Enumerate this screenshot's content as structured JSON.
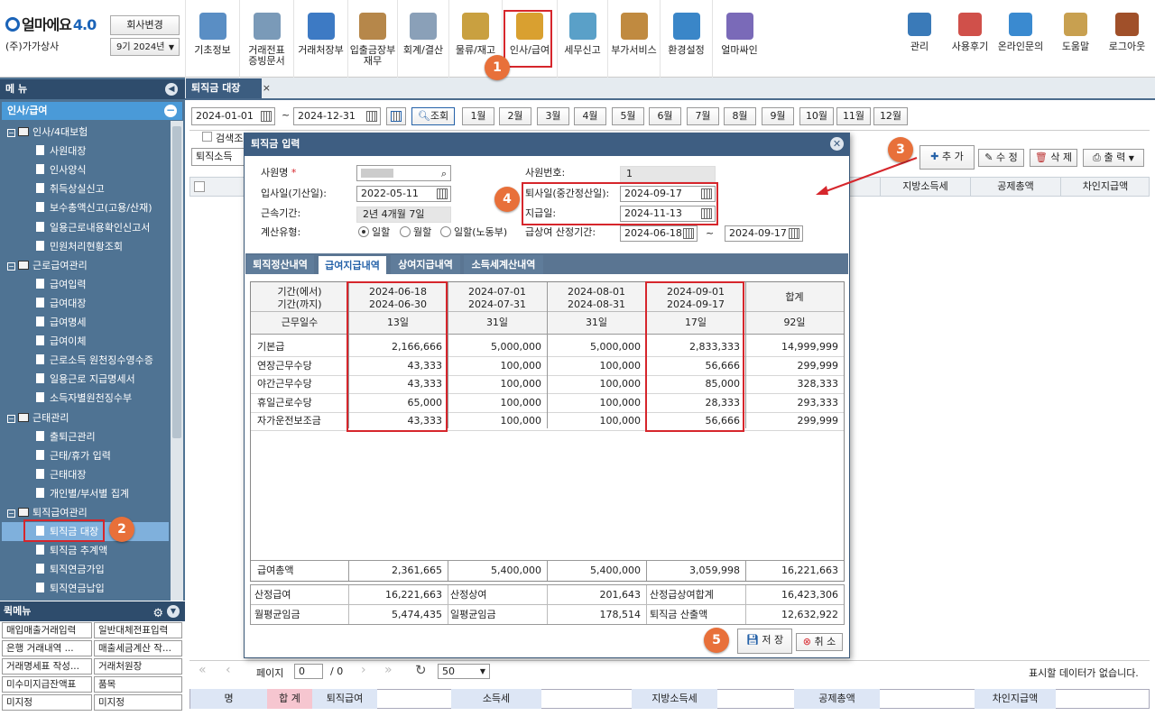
{
  "app": {
    "logo": "얼마에요",
    "version": "4.0",
    "company": "(주)가가상사",
    "change_company": "회사변경",
    "period": "9기 2024년"
  },
  "toolbar": [
    {
      "label": "기초정보",
      "icon": "basic-info-icon"
    },
    {
      "label": "거래전표\n증빙문서",
      "icon": "voucher-icon"
    },
    {
      "label": "거래처장부",
      "icon": "ledger-icon"
    },
    {
      "label": "입출금장부\n재무",
      "icon": "cashbook-icon"
    },
    {
      "label": "회계/결산",
      "icon": "accounting-icon"
    },
    {
      "label": "물류/재고",
      "icon": "logistics-icon"
    },
    {
      "label": "인사/급여",
      "icon": "hr-payroll-icon"
    },
    {
      "label": "세무신고",
      "icon": "tax-icon"
    },
    {
      "label": "부가서비스",
      "icon": "service-icon"
    },
    {
      "label": "환경설정",
      "icon": "settings-gear-icon"
    },
    {
      "label": "얼마싸인",
      "icon": "sign-icon"
    }
  ],
  "right_toolbar": [
    {
      "label": "관리",
      "icon": "puzzle-icon"
    },
    {
      "label": "사용후기",
      "icon": "review-icon"
    },
    {
      "label": "온라인문의",
      "icon": "inquiry-icon"
    },
    {
      "label": "도움말",
      "icon": "help-book-icon"
    },
    {
      "label": "로그아웃",
      "icon": "logout-door-icon"
    }
  ],
  "sidebar": {
    "title": "메 뉴",
    "section": "인사/급여",
    "tree": [
      {
        "label": "인사/4대보험",
        "type": "folder"
      },
      {
        "label": "사원대장",
        "type": "doc"
      },
      {
        "label": "인사양식",
        "type": "doc"
      },
      {
        "label": "취득상실신고",
        "type": "doc"
      },
      {
        "label": "보수총액신고(고용/산재)",
        "type": "doc"
      },
      {
        "label": "일용근로내용확인신고서",
        "type": "doc"
      },
      {
        "label": "민원처리현황조회",
        "type": "doc"
      },
      {
        "label": "근로급여관리",
        "type": "folder"
      },
      {
        "label": "급여입력",
        "type": "doc"
      },
      {
        "label": "급여대장",
        "type": "doc"
      },
      {
        "label": "급여명세",
        "type": "doc"
      },
      {
        "label": "급여이체",
        "type": "doc"
      },
      {
        "label": "근로소득 원천징수영수증",
        "type": "doc"
      },
      {
        "label": "일용근로 지급명세서",
        "type": "doc"
      },
      {
        "label": "소득자별원천징수부",
        "type": "doc"
      },
      {
        "label": "근태관리",
        "type": "folder"
      },
      {
        "label": "출퇴근관리",
        "type": "doc"
      },
      {
        "label": "근태/휴가 입력",
        "type": "doc"
      },
      {
        "label": "근태대장",
        "type": "doc"
      },
      {
        "label": "개인별/부서별 집계",
        "type": "doc"
      },
      {
        "label": "퇴직급여관리",
        "type": "folder"
      },
      {
        "label": "퇴직금 대장",
        "type": "doc",
        "selected": true
      },
      {
        "label": "퇴직금 추계액",
        "type": "doc"
      },
      {
        "label": "퇴직연금가입",
        "type": "doc"
      },
      {
        "label": "퇴직연금납입",
        "type": "doc"
      }
    ],
    "quick_title": "퀵메뉴",
    "quick": [
      "매입매출거래입력",
      "일반대체전표입력",
      "은행 거래내역 ...",
      "매출세금계산 작...",
      "거래명세표 작성...",
      "거래처원장",
      "미수미지급잔액표",
      "품목",
      "미지정",
      "미지정"
    ]
  },
  "tab": {
    "label": "퇴직금 대장"
  },
  "filter": {
    "from": "2024-01-01",
    "to": "2024-12-31",
    "search": "조회",
    "months": [
      "1월",
      "2월",
      "3월",
      "4월",
      "5월",
      "6월",
      "7월",
      "8월",
      "9월",
      "10월",
      "11월",
      "12월"
    ],
    "check_label": "검색조",
    "combo": "퇴직소득"
  },
  "actions": {
    "add": "추 가",
    "edit": "수 정",
    "delete": "삭 제",
    "print": "출 력"
  },
  "grid_headers": [
    "지방소득세",
    "공제총액",
    "차인지급액"
  ],
  "pager": {
    "page_label": "페이지",
    "page": "0",
    "of": "/ 0",
    "size": "50",
    "empty": "표시할 데이터가 없습니다."
  },
  "summary": {
    "name": "명",
    "total": "합 계",
    "retire": "퇴직급여",
    "income_tax": "소득세",
    "local_tax": "지방소득세",
    "deduct": "공제총액",
    "net": "차인지급액"
  },
  "modal": {
    "title": "퇴직금 입력",
    "employee_label": "사원명",
    "employee_no_label": "사원번호:",
    "employee_no": "1",
    "join_label": "입사일(기산일):",
    "join": "2022-05-11",
    "retire_label": "퇴사일(중간정산일):",
    "retire": "2024-09-17",
    "service_label": "근속기간:",
    "service": "2년 4개월 7일",
    "pay_label": "지급일:",
    "pay": "2024-11-13",
    "calc_label": "계산유형:",
    "calc_options": [
      "일할",
      "월할",
      "일할(노동부)"
    ],
    "bonus_label": "급상여 산정기간:",
    "bonus_from": "2024-06-18",
    "bonus_to": "2024-09-17",
    "tabs": [
      "퇴직정산내역",
      "급여지급내역",
      "상여지급내역",
      "소득세계산내역"
    ],
    "table": {
      "period_labels": [
        "기간(에서)",
        "기간(까지)"
      ],
      "workdays_label": "근무일수",
      "total_label": "합계",
      "periods": [
        {
          "from": "2024-06-18",
          "to": "2024-06-30",
          "days": "13일"
        },
        {
          "from": "2024-07-01",
          "to": "2024-07-31",
          "days": "31일"
        },
        {
          "from": "2024-08-01",
          "to": "2024-08-31",
          "days": "31일"
        },
        {
          "from": "2024-09-01",
          "to": "2024-09-17",
          "days": "17일"
        }
      ],
      "total_days": "92일",
      "rows": [
        {
          "item": "기본급",
          "values": [
            "2,166,666",
            "5,000,000",
            "5,000,000",
            "2,833,333"
          ],
          "total": "14,999,999"
        },
        {
          "item": "연장근무수당",
          "values": [
            "43,333",
            "100,000",
            "100,000",
            "56,666"
          ],
          "total": "299,999"
        },
        {
          "item": "야간근무수당",
          "values": [
            "43,333",
            "100,000",
            "100,000",
            "85,000"
          ],
          "total": "328,333"
        },
        {
          "item": "휴일근로수당",
          "values": [
            "65,000",
            "100,000",
            "100,000",
            "28,333"
          ],
          "total": "293,333"
        },
        {
          "item": "자가운전보조금",
          "values": [
            "43,333",
            "100,000",
            "100,000",
            "56,666"
          ],
          "total": "299,999"
        }
      ],
      "sum_label": "급여총액",
      "sum_values": [
        "2,361,665",
        "5,400,000",
        "5,400,000",
        "3,059,998"
      ],
      "sum_total": "16,221,663"
    },
    "summary": [
      {
        "l1": "산정급여",
        "v1": "16,221,663",
        "l2": "산정상여",
        "v2": "201,643",
        "l3": "산정급상여합계",
        "v3": "16,423,306"
      },
      {
        "l1": "월평균임금",
        "v1": "5,474,435",
        "l2": "일평균임금",
        "v2": "178,514",
        "l3": "퇴직금 산출액",
        "v3": "12,632,922"
      }
    ],
    "save": "저 장",
    "cancel": "취 소"
  },
  "badges": [
    "1",
    "2",
    "3",
    "4",
    "5"
  ],
  "colors": {
    "accent": "#3e5e82",
    "highlight": "#d6262c",
    "badge": "#e8703a"
  }
}
